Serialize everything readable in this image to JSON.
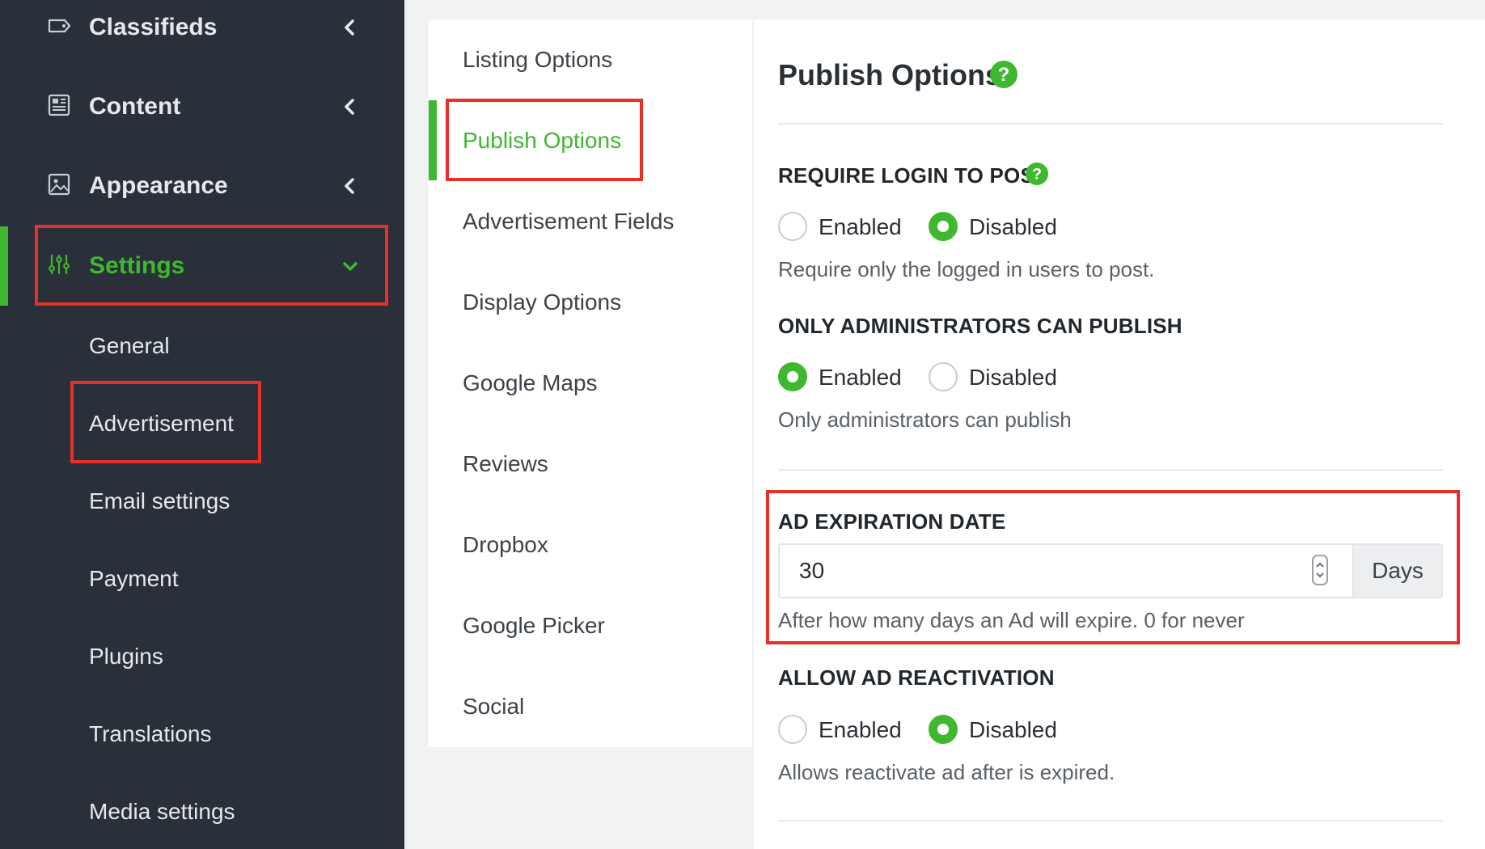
{
  "colors": {
    "accent": "#3fb82f",
    "sidebar_bg": "#293039",
    "highlight": "#e8302a"
  },
  "sidebar": {
    "items": [
      {
        "label": "Classifieds",
        "icon": "tag-icon"
      },
      {
        "label": "Content",
        "icon": "newspaper-icon"
      },
      {
        "label": "Appearance",
        "icon": "image-icon"
      },
      {
        "label": "Settings",
        "icon": "sliders-icon"
      }
    ],
    "sub_items": [
      {
        "label": "General"
      },
      {
        "label": "Advertisement"
      },
      {
        "label": "Email settings"
      },
      {
        "label": "Payment"
      },
      {
        "label": "Plugins"
      },
      {
        "label": "Translations"
      },
      {
        "label": "Media settings"
      }
    ]
  },
  "subnav": {
    "tabs": [
      {
        "label": "Listing Options"
      },
      {
        "label": "Publish Options"
      },
      {
        "label": "Advertisement Fields"
      },
      {
        "label": "Display Options"
      },
      {
        "label": "Google Maps"
      },
      {
        "label": "Reviews"
      },
      {
        "label": "Dropbox"
      },
      {
        "label": "Google Picker"
      },
      {
        "label": "Social"
      }
    ]
  },
  "main": {
    "title": "Publish Options",
    "sections": {
      "require_login": {
        "title": "REQUIRE LOGIN TO POST",
        "enabled_label": "Enabled",
        "disabled_label": "Disabled",
        "selected": "Disabled",
        "help": "Require only the logged in users to post."
      },
      "admin_publish": {
        "title": "ONLY ADMINISTRATORS CAN PUBLISH",
        "enabled_label": "Enabled",
        "disabled_label": "Disabled",
        "selected": "Enabled",
        "help": "Only administrators can publish"
      },
      "expiration": {
        "title": "AD EXPIRATION DATE",
        "value": "30",
        "addon": "Days",
        "help": "After how many days an Ad will expire. 0 for never"
      },
      "reactivation": {
        "title": "ALLOW AD REACTIVATION",
        "enabled_label": "Enabled",
        "disabled_label": "Disabled",
        "selected": "Disabled",
        "help": "Allows reactivate ad after is expired."
      }
    }
  }
}
